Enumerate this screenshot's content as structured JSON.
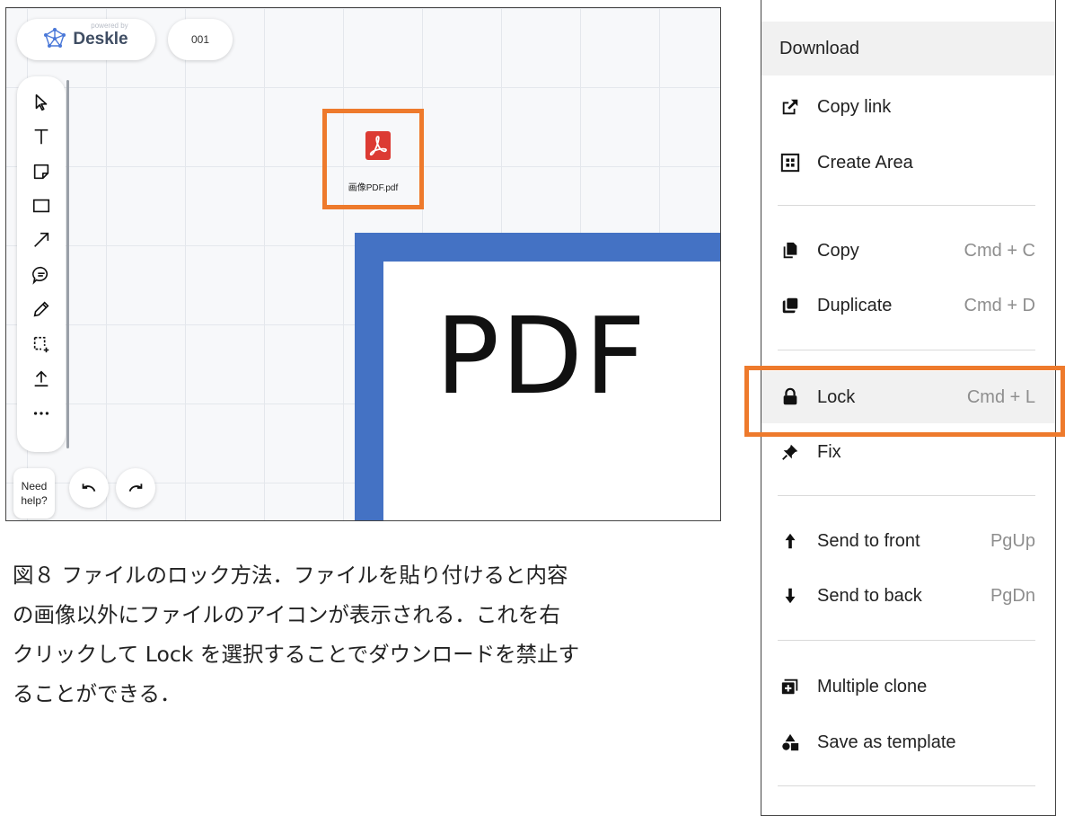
{
  "board": {
    "brand_powered": "powered by",
    "brand_name": "Deskle",
    "board_name": "001",
    "help_line1": "Need",
    "help_line2": "help?",
    "file_name": "画像PDF.pdf",
    "pdf_content_text": "PDF"
  },
  "toolbar_tools": [
    "select-cursor-icon",
    "text-tool-icon",
    "sticky-note-icon",
    "rectangle-icon",
    "arrow-icon",
    "comment-icon",
    "pen-icon",
    "area-select-icon",
    "upload-icon",
    "more-icon"
  ],
  "caption": {
    "line1": "図８ ファイルのロック方法．ファイルを貼り付けると内容",
    "line2": "の画像以外にファイルのアイコンが表示される．これを右",
    "line3": "クリックして Lock を選択することでダウンロードを禁止す",
    "line4": "ることができる．"
  },
  "menu": {
    "download": "Download",
    "copy_link": "Copy link",
    "create_area": "Create Area",
    "copy": "Copy",
    "copy_sc": "Cmd + C",
    "duplicate": "Duplicate",
    "duplicate_sc": "Cmd + D",
    "lock": "Lock",
    "lock_sc": "Cmd + L",
    "fix": "Fix",
    "send_front": "Send to front",
    "send_front_sc": "PgUp",
    "send_back": "Send to back",
    "send_back_sc": "PgDn",
    "multiple_clone": "Multiple clone",
    "save_template": "Save as template"
  },
  "colors": {
    "highlight_orange": "#ee7a2c",
    "pdf_frame_blue": "#4472c4",
    "pdf_icon_red": "#dc3b33",
    "brand_blue": "#4a78d8"
  }
}
